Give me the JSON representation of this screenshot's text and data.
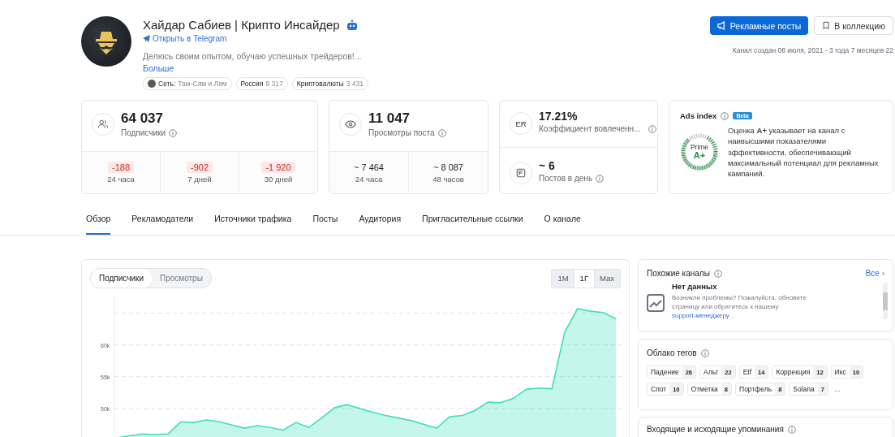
{
  "channel": {
    "title": "Хайдар Сабиев | Крипто Инсайдер",
    "bot": true,
    "open_link": "Открыть в Telegram",
    "description": "Делюсь своим опытом, обучаю успешных трейдеров!...",
    "more": "Больше",
    "chips": [
      {
        "label": "Сеть:",
        "value": "Там-Сям и Лям",
        "kind": "network"
      },
      {
        "label": "Россия",
        "value": "9 317",
        "kind": "plain"
      },
      {
        "label": "Криптовалюты",
        "value": "3 431",
        "kind": "plain"
      }
    ]
  },
  "actions": [
    {
      "label": "Рекламные посты",
      "kind": "primary"
    },
    {
      "label": "В коллекцию",
      "kind": "secondary"
    }
  ],
  "created": "Канал создан 08 июля, 2021 - 3 года 7 месяцев 22",
  "subscribers": {
    "value": "64 037",
    "label": "Подписчики",
    "periods": [
      {
        "value": "-188",
        "label": "24 часа",
        "kind": "decrease"
      },
      {
        "value": "-902",
        "label": "7 дней",
        "kind": "decrease"
      },
      {
        "value": "-1 920",
        "label": "30 дней",
        "kind": "decrease"
      }
    ]
  },
  "views": {
    "value": "11 047",
    "label": "Просмотры поста",
    "periods": [
      {
        "value": "~ 7 464",
        "label": "24 часа"
      },
      {
        "value": "~ 8 087",
        "label": "48 часов"
      }
    ]
  },
  "er": {
    "badge": "ER",
    "value": "17.21%",
    "label": "Коэффициент вовлеченн..."
  },
  "posts_per_day": {
    "value": "~ 6",
    "label": "Постов в день"
  },
  "ads_index": {
    "title": "Ads index",
    "beta": "Beta",
    "grade_label": "Prime",
    "grade": "A+",
    "level": 0.8,
    "text": "Оценка **A+** указывает на канал с наивысшими показателями эффективности, обеспечивающий максимальный потенциал для рекламных кампаний."
  },
  "tabs": [
    {
      "label": "Обзор",
      "selected": true
    },
    {
      "label": "Рекламодатели",
      "selected": false
    },
    {
      "label": "Источники трафика",
      "selected": false
    },
    {
      "label": "Посты",
      "selected": false
    },
    {
      "label": "Аудитория",
      "selected": false
    },
    {
      "label": "Пригласительные ссылки",
      "selected": false
    },
    {
      "label": "О канале",
      "selected": false
    }
  ],
  "chart_panel": {
    "metrics": [
      {
        "label": "Подписчики",
        "selected": true
      },
      {
        "label": "Просмотры",
        "selected": false
      }
    ],
    "ranges": [
      {
        "label": "1M",
        "selected": false
      },
      {
        "label": "1Г",
        "selected": true
      },
      {
        "label": "Max",
        "selected": false
      }
    ],
    "chart_data": {
      "type": "area",
      "grid": true,
      "ylim": [
        45000,
        68000
      ],
      "series": [
        {
          "color": "#3ee0b8",
          "values": [
            45400,
            45700,
            46000,
            45900,
            46000,
            47900,
            47800,
            48200,
            47900,
            47400,
            46900,
            47300,
            47000,
            46600,
            47800,
            47000,
            48500,
            50100,
            50600,
            50000,
            49400,
            48900,
            48500,
            48100,
            47500,
            46900,
            48700,
            48900,
            49700,
            51000,
            50900,
            51600,
            53000,
            53200,
            53100,
            62000,
            65700,
            65300,
            65100,
            64100
          ]
        }
      ],
      "yticks": [
        {
          "value": 50000,
          "label": "50k"
        },
        {
          "value": 55000,
          "label": "55k"
        },
        {
          "value": 60000,
          "label": "60k"
        }
      ]
    }
  },
  "similar": {
    "title": "Похожие каналы",
    "all": "Все ›",
    "empty_title": "Нет данных",
    "empty_text": "Возникли проблемы? Пожалуйста, обновите страницу или обратитесь к нашему",
    "link": "support-менеджеру",
    "end": "."
  },
  "tag_cloud": {
    "title": "Облако тегов",
    "tags": [
      {
        "label": "Падение",
        "count": "26"
      },
      {
        "label": "Альт",
        "count": "22"
      },
      {
        "label": "Etf",
        "count": "14"
      },
      {
        "label": "Коррекция",
        "count": "12"
      },
      {
        "label": "Икс",
        "count": "10"
      },
      {
        "label": "Спот",
        "count": "10"
      },
      {
        "label": "Отметка",
        "count": "8"
      },
      {
        "label": "Портфель",
        "count": "8"
      },
      {
        "label": "Solana",
        "count": "7"
      }
    ],
    "more": "..."
  },
  "mentions": {
    "title": "Входящие и исходящие упоминания"
  }
}
